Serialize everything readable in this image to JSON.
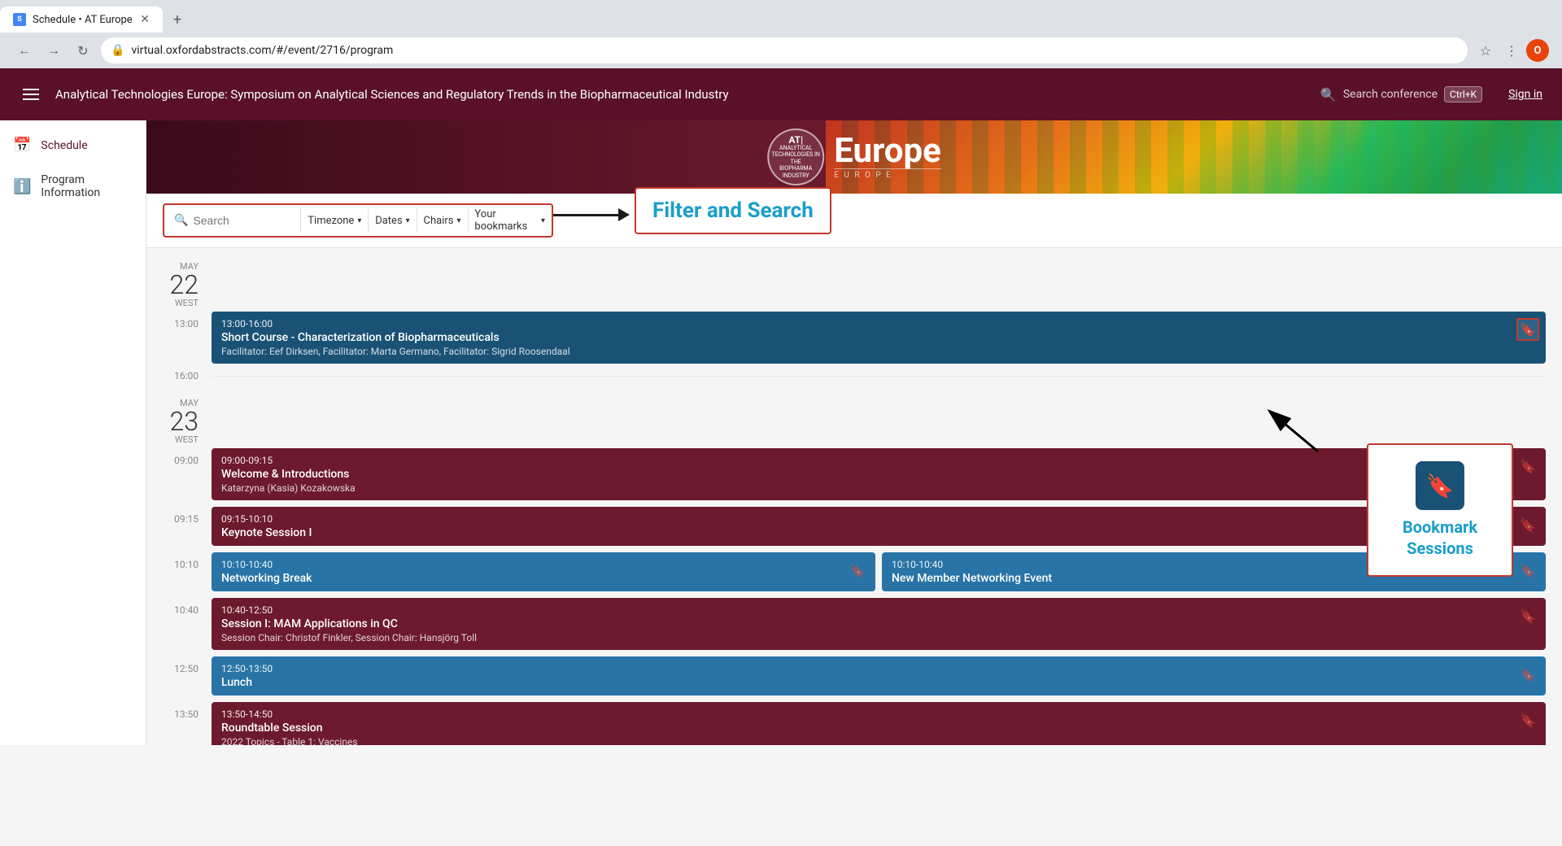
{
  "browser": {
    "tab_title": "Schedule • AT Europe",
    "tab_favicon": "S",
    "url": "virtual.oxfordabstracts.com/#/event/2716/program",
    "new_tab_icon": "+",
    "nav_back": "←",
    "nav_forward": "→",
    "nav_refresh": "↻",
    "profile_initial": "O"
  },
  "header": {
    "title": "Analytical Technologies Europe: Symposium on Analytical Sciences and Regulatory Trends in the Biopharmaceutical Industry",
    "search_placeholder": "Search conference",
    "keyboard_shortcut": "Ctrl+K",
    "sign_in": "Sign in"
  },
  "sidebar": {
    "items": [
      {
        "label": "Schedule",
        "icon": "calendar"
      },
      {
        "label": "Program Information",
        "icon": "info"
      }
    ]
  },
  "banner": {
    "logo_title": "AT|",
    "logo_subtitle": "ANALYTICAL\nTECHNOLOGIES IN THE\nBIOPHARMACEUTICAL\nINDUSTRY",
    "brand": "Europe"
  },
  "filter_bar": {
    "search_placeholder": "Search",
    "timezone_label": "Timezone",
    "dates_label": "Dates",
    "chairs_label": "Chairs",
    "bookmarks_label": "Your bookmarks"
  },
  "annotations": {
    "filter_and_search": "Filter and Search",
    "bookmark_sessions": "Bookmark\nSessions"
  },
  "schedule": {
    "days": [
      {
        "month": "MAY",
        "day": "22",
        "week_label": "WEST",
        "times": [
          {
            "time": "13:00",
            "sessions": [
              {
                "color": "blue",
                "time_range": "13:00-16:00",
                "title": "Short Course - Characterization of Biopharmaceuticals",
                "subtitle": "Facilitator: Eef Dirksen, Facilitator: Marta Germano, Facilitator: Sigrid Roosendaal",
                "bookmarked": true,
                "bookmark_highlighted": true
              }
            ]
          },
          {
            "time": "16:00",
            "sessions": []
          }
        ]
      },
      {
        "month": "MAY",
        "day": "23",
        "week_label": "WEST",
        "times": [
          {
            "time": "09:00",
            "sessions": [
              {
                "color": "dark-red",
                "time_range": "09:00-09:15",
                "title": "Welcome & Introductions",
                "subtitle": "Katarzyna (Kasia) Kozakowska",
                "bookmarked": false
              }
            ]
          },
          {
            "time": "09:15",
            "sessions": [
              {
                "color": "dark-red",
                "time_range": "09:15-10:10",
                "title": "Keynote Session I",
                "subtitle": "",
                "bookmarked": false
              }
            ]
          },
          {
            "time": "10:10",
            "sessions_multi": [
              {
                "color": "medium-blue",
                "time_range": "10:10-10:40",
                "title": "Networking Break",
                "subtitle": "",
                "bookmarked": false
              },
              {
                "color": "medium-blue",
                "time_range": "10:10-10:40",
                "title": "New Member Networking Event",
                "subtitle": "",
                "bookmarked": false,
                "right_column": true
              }
            ]
          },
          {
            "time": "10:40",
            "sessions": [
              {
                "color": "dark-red",
                "time_range": "10:40-12:50",
                "title": "Session I: MAM Applications in QC",
                "subtitle": "Session Chair: Christof Finkler, Session Chair: Hansjörg Toll",
                "bookmarked": false
              }
            ]
          },
          {
            "time": "12:50",
            "sessions": [
              {
                "color": "medium-blue",
                "time_range": "12:50-13:50",
                "title": "Lunch",
                "subtitle": "",
                "bookmarked": false
              }
            ]
          },
          {
            "time": "13:50",
            "sessions": [
              {
                "color": "dark-red",
                "time_range": "13:50-14:50",
                "title": "Roundtable Session",
                "subtitle": "2022 Topics -\nTable 1: Vaccines",
                "bookmarked": false
              }
            ]
          }
        ]
      }
    ]
  }
}
